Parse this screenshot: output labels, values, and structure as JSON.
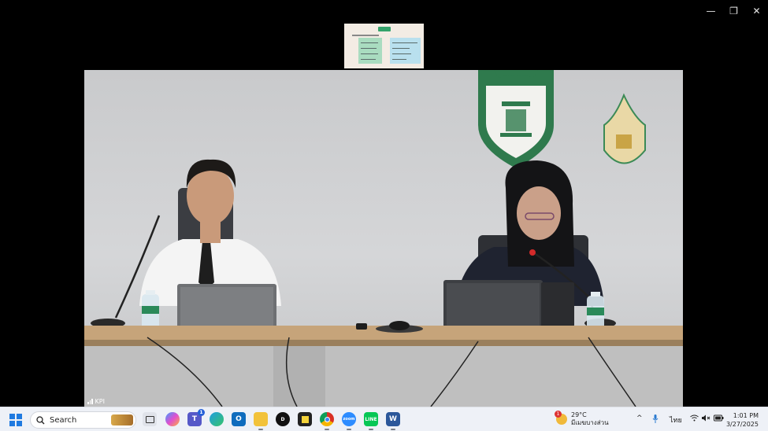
{
  "window": {
    "minimize_glyph": "—",
    "restore_glyph": "❐",
    "close_glyph": "✕"
  },
  "video": {
    "participant_name": "KPI"
  },
  "taskbar": {
    "search_label": "Search",
    "weather": {
      "temperature": "29°C",
      "condition": "มีเมฆบางส่วน",
      "badge_count": "1"
    },
    "tray": {
      "language": "ไทย"
    },
    "clock": {
      "time": "1:01 PM",
      "date": "3/27/2025"
    },
    "apps": [
      {
        "name": "task-view-icon"
      },
      {
        "name": "copilot-icon"
      },
      {
        "name": "teams-icon",
        "badge": "1"
      },
      {
        "name": "edge-icon"
      },
      {
        "name": "outlook-icon"
      },
      {
        "name": "file-explorer-icon"
      },
      {
        "name": "dell-icon"
      },
      {
        "name": "sticky-notes-icon"
      },
      {
        "name": "chrome-icon"
      },
      {
        "name": "zoom-icon"
      },
      {
        "name": "line-icon"
      },
      {
        "name": "word-icon"
      }
    ]
  }
}
